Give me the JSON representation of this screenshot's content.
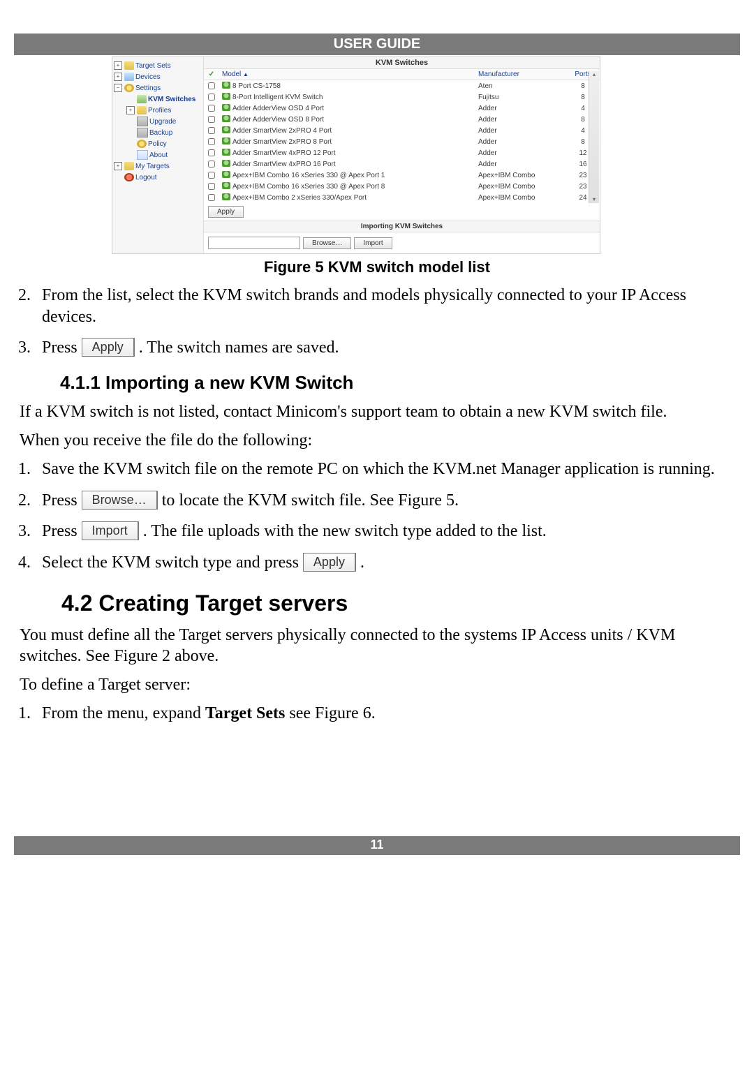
{
  "header": {
    "title": "USER GUIDE"
  },
  "footer": {
    "page": "11"
  },
  "tree": {
    "items": [
      {
        "label": "Target Sets",
        "exp": "+",
        "icon": "ic-folder",
        "name": "tree-target-sets",
        "cls": ""
      },
      {
        "label": "Devices",
        "exp": "+",
        "icon": "ic-folder2",
        "name": "tree-devices",
        "cls": ""
      },
      {
        "label": "Settings",
        "exp": "−",
        "icon": "ic-gear",
        "name": "tree-settings",
        "cls": ""
      },
      {
        "label": "KVM Switches",
        "exp": "",
        "icon": "ic-device",
        "name": "tree-kvm-switches",
        "cls": "indent-1 tree-active"
      },
      {
        "label": "Profiles",
        "exp": "+",
        "icon": "ic-folder",
        "name": "tree-profiles",
        "cls": "indent-1"
      },
      {
        "label": "Upgrade",
        "exp": "",
        "icon": "ic-box",
        "name": "tree-upgrade",
        "cls": "indent-1"
      },
      {
        "label": "Backup",
        "exp": "",
        "icon": "ic-box",
        "name": "tree-backup",
        "cls": "indent-1"
      },
      {
        "label": "Policy",
        "exp": "",
        "icon": "ic-gear",
        "name": "tree-policy",
        "cls": "indent-1"
      },
      {
        "label": "About",
        "exp": "",
        "icon": "ic-doc",
        "name": "tree-about",
        "cls": "indent-1"
      },
      {
        "label": "My Targets",
        "exp": "+",
        "icon": "ic-folder",
        "name": "tree-my-targets",
        "cls": ""
      },
      {
        "label": "Logout",
        "exp": "",
        "icon": "ic-red",
        "name": "tree-logout",
        "cls": ""
      }
    ]
  },
  "pane": {
    "title": "KVM Switches",
    "columns": {
      "check": "✓",
      "model": "Model",
      "manufacturer": "Manufacturer",
      "ports": "Ports",
      "sort": "▲"
    },
    "rows": [
      {
        "model": "8 Port CS-1758",
        "manufacturer": "Aten",
        "ports": "8"
      },
      {
        "model": "8-Port Intelligent KVM Switch",
        "manufacturer": "Fujitsu",
        "ports": "8"
      },
      {
        "model": "Adder AdderView OSD 4 Port",
        "manufacturer": "Adder",
        "ports": "4"
      },
      {
        "model": "Adder AdderView OSD 8 Port",
        "manufacturer": "Adder",
        "ports": "8"
      },
      {
        "model": "Adder SmartView 2xPRO 4 Port",
        "manufacturer": "Adder",
        "ports": "4"
      },
      {
        "model": "Adder SmartView 2xPRO 8 Port",
        "manufacturer": "Adder",
        "ports": "8"
      },
      {
        "model": "Adder SmartView 4xPRO 12 Port",
        "manufacturer": "Adder",
        "ports": "12"
      },
      {
        "model": "Adder SmartView 4xPRO 16 Port",
        "manufacturer": "Adder",
        "ports": "16"
      },
      {
        "model": "Apex+IBM Combo 16 xSeries 330 @ Apex Port 1",
        "manufacturer": "Apex+IBM Combo",
        "ports": "23"
      },
      {
        "model": "Apex+IBM Combo 16 xSeries 330 @ Apex Port 8",
        "manufacturer": "Apex+IBM Combo",
        "ports": "23"
      },
      {
        "model": "Apex+IBM Combo 2 xSeries 330/Apex Port",
        "manufacturer": "Apex+IBM Combo",
        "ports": "24"
      }
    ],
    "apply_label": "Apply",
    "import_title": "Importing KVM Switches",
    "browse_label": "Browse…",
    "import_label": "Import"
  },
  "doc": {
    "caption": "Figure 5 KVM switch model list",
    "step2": "From the list, select the KVM switch brands and models physically connected to your IP Access devices.",
    "step3_a": "Press ",
    "step3_btn": "Apply",
    "step3_b": ". The switch names are saved.",
    "h411": "4.1.1 Importing a new KVM Switch",
    "p411a": "If a KVM switch is not listed, contact Minicom's support team to obtain a new KVM switch file.",
    "p411b": "When you receive the file do the following:",
    "s1": "Save the KVM switch file on the remote PC on which the KVM.net Manager application is running.",
    "s2_a": "Press ",
    "s2_btn": "Browse…",
    "s2_b": " to locate the KVM switch file. See Figure 5.",
    "s3_a": "Press ",
    "s3_btn": "Import",
    "s3_b": ". The file uploads with the new switch type added to the list.",
    "s4_a": "Select the KVM switch type and press ",
    "s4_btn": "Apply",
    "s4_b": ".",
    "h42": "4.2  Creating Target servers",
    "p42a": "You must define all the Target servers physically connected to the systems IP Access units / KVM switches. See Figure 2 above.",
    "p42b": "To define a Target server:",
    "d1_a": "From the menu, expand ",
    "d1_bold": "Target Sets",
    "d1_b": " see Figure 6."
  }
}
